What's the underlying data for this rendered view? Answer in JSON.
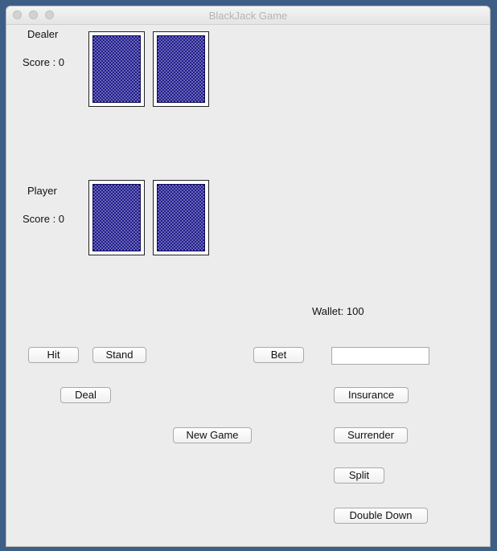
{
  "window": {
    "title": "BlackJack Game"
  },
  "dealer": {
    "label": "Dealer",
    "score_text": "Score : 0"
  },
  "player": {
    "label": "Player",
    "score_text": "Score : 0"
  },
  "wallet": {
    "text": "Wallet: 100"
  },
  "bet": {
    "input_value": ""
  },
  "buttons": {
    "hit": "Hit",
    "stand": "Stand",
    "bet": "Bet",
    "deal": "Deal",
    "insurance": "Insurance",
    "new_game": "New Game",
    "surrender": "Surrender",
    "split": "Split",
    "double_down": "Double Down"
  },
  "colors": {
    "card_back": "#1e1a8c",
    "desktop": "#3d5f86"
  }
}
